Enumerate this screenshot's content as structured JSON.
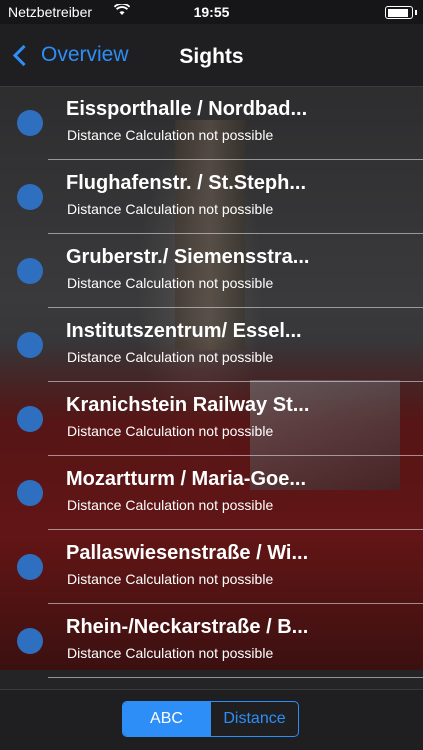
{
  "status_bar": {
    "carrier": "Netzbetreiber",
    "wifi_icon": "wifi-icon",
    "time": "19:55",
    "battery_icon": "battery-icon"
  },
  "nav": {
    "back_label": "Overview",
    "title": "Sights"
  },
  "list": [
    {
      "title": "Eissporthalle / Nordbad...",
      "subtitle": "Distance Calculation not possible"
    },
    {
      "title": "Flughafenstr. / St.Steph...",
      "subtitle": "Distance Calculation not possible"
    },
    {
      "title": "Gruberstr./ Siemensstra...",
      "subtitle": "Distance Calculation not possible"
    },
    {
      "title": "Institutszentrum/ Essel...",
      "subtitle": "Distance Calculation not possible"
    },
    {
      "title": "Kranichstein Railway St...",
      "subtitle": "Distance Calculation not possible"
    },
    {
      "title": "Mozartturm / Maria-Goe...",
      "subtitle": "Distance Calculation not possible"
    },
    {
      "title": "Pallaswiesenstraße / Wi...",
      "subtitle": "Distance Calculation not possible"
    },
    {
      "title": "Rhein-/Neckarstraße / B...",
      "subtitle": "Distance Calculation not possible"
    }
  ],
  "toolbar": {
    "sort_abc": "ABC",
    "sort_distance": "Distance"
  },
  "colors": {
    "accent": "#2d8ef7",
    "dot": "#2e6fc0"
  }
}
